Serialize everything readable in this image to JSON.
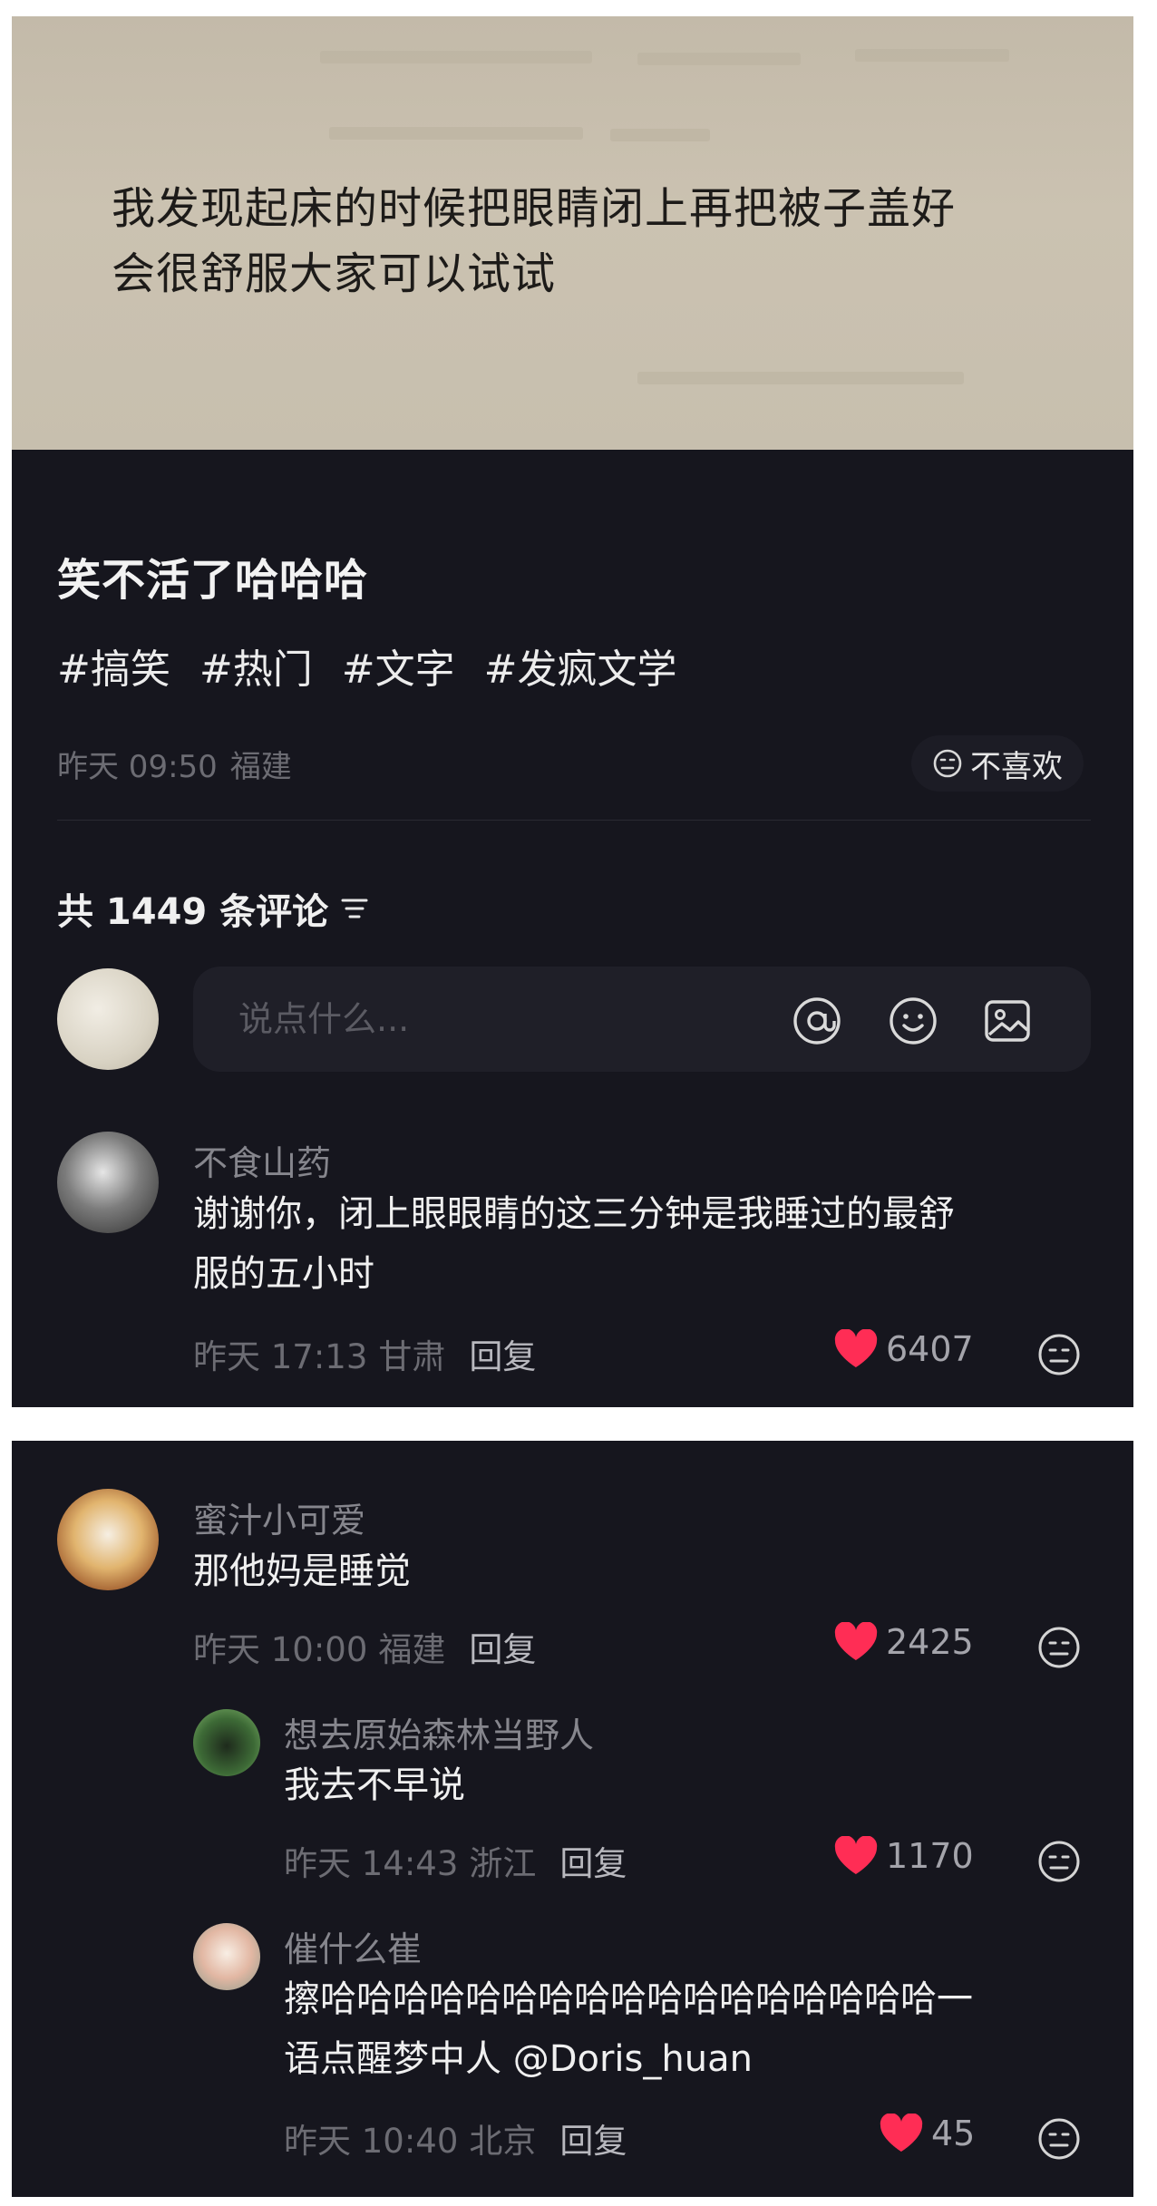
{
  "post": {
    "image_text_line1": "我发现起床的时候把眼睛闭上再把被子盖好",
    "image_text_line2": "会很舒服大家可以试试",
    "title": "笑不活了哈哈哈",
    "tags": [
      "#搞笑",
      "#热门",
      "#文字",
      "#发疯文学"
    ],
    "time": "昨天 09:50",
    "location": "福建",
    "dislike_label": "不喜欢"
  },
  "comments_header": {
    "count_label": "共 1449 条评论"
  },
  "composer": {
    "placeholder": "说点什么..."
  },
  "comments": [
    {
      "user": "不食山药",
      "text_line1": "谢谢你，闭上眼眼睛的这三分钟是我睡过的最舒",
      "text_line2": "服的五小时",
      "time": "昨天 17:13",
      "location": "甘肃",
      "reply": "回复",
      "likes": "6407"
    },
    {
      "user": "蜜汁小可爱",
      "text_line1": "那他妈是睡觉",
      "time": "昨天 10:00",
      "location": "福建",
      "reply": "回复",
      "likes": "2425"
    },
    {
      "user": "想去原始森林当野人",
      "text_line1": "我去不早说",
      "time": "昨天 14:43",
      "location": "浙江",
      "reply": "回复",
      "likes": "1170"
    },
    {
      "user": "催什么崔",
      "text_line1": "擦哈哈哈哈哈哈哈哈哈哈哈哈哈哈哈哈哈一",
      "text_line2": "语点醒梦中人 @Doris_huan",
      "time": "昨天 10:40",
      "location": "北京",
      "reply": "回复",
      "likes": "45"
    }
  ],
  "icons": {
    "at": "at-icon",
    "emoji": "emoji-icon",
    "image": "image-icon",
    "sort": "sort-icon",
    "heart": "heart-icon",
    "dislike": "dislike-face-icon"
  },
  "colors": {
    "background": "#16161e",
    "heart": "#ff2d55",
    "text": "#f0f0f0",
    "muted": "#6c6c73"
  }
}
